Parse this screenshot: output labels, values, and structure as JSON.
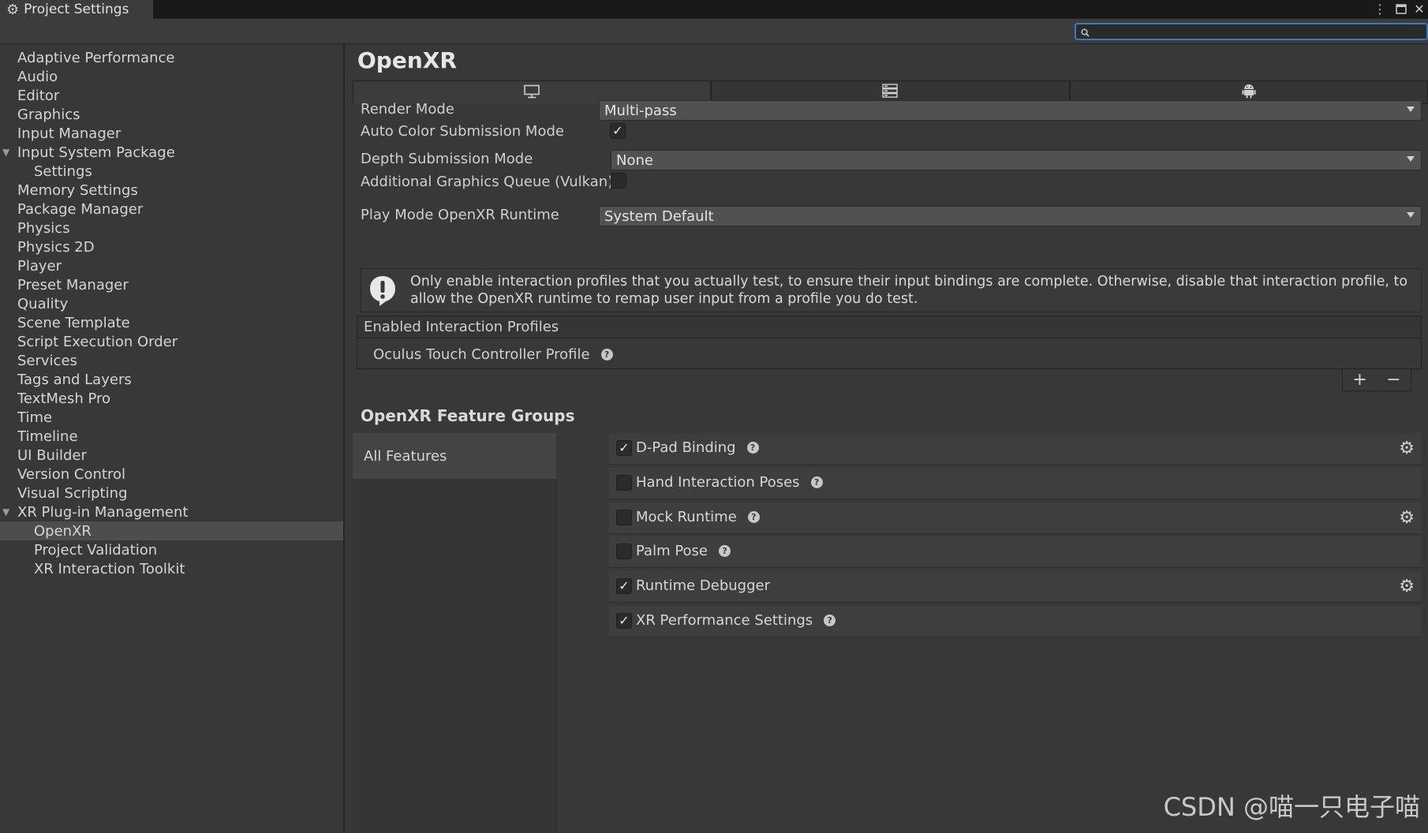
{
  "window": {
    "title": "Project Settings",
    "menu_icon": "kebab-menu-icon",
    "maximize_icon": "maximize-icon",
    "close_icon": "close-icon"
  },
  "search": {
    "value": "",
    "placeholder": ""
  },
  "sidebar": {
    "items": [
      {
        "label": "Adaptive Performance"
      },
      {
        "label": "Audio"
      },
      {
        "label": "Editor"
      },
      {
        "label": "Graphics"
      },
      {
        "label": "Input Manager"
      },
      {
        "label": "Input System Package"
      },
      {
        "label": "Settings"
      },
      {
        "label": "Memory Settings"
      },
      {
        "label": "Package Manager"
      },
      {
        "label": "Physics"
      },
      {
        "label": "Physics 2D"
      },
      {
        "label": "Player"
      },
      {
        "label": "Preset Manager"
      },
      {
        "label": "Quality"
      },
      {
        "label": "Scene Template"
      },
      {
        "label": "Script Execution Order"
      },
      {
        "label": "Services"
      },
      {
        "label": "Tags and Layers"
      },
      {
        "label": "TextMesh Pro"
      },
      {
        "label": "Time"
      },
      {
        "label": "Timeline"
      },
      {
        "label": "UI Builder"
      },
      {
        "label": "Version Control"
      },
      {
        "label": "Visual Scripting"
      },
      {
        "label": "XR Plug-in Management"
      },
      {
        "label": "OpenXR"
      },
      {
        "label": "Project Validation"
      },
      {
        "label": "XR Interaction Toolkit"
      }
    ],
    "selected": "OpenXR"
  },
  "main": {
    "title": "OpenXR",
    "platform_tabs": [
      {
        "icon": "desktop-monitor-icon",
        "active": true
      },
      {
        "icon": "server-stack-icon",
        "active": false
      },
      {
        "icon": "android-icon",
        "active": false
      }
    ],
    "render_mode": {
      "label": "Render Mode",
      "value": "Multi-pass"
    },
    "auto_color": {
      "label": "Auto Color Submission Mode",
      "checked": true
    },
    "depth_mode": {
      "label": "Depth Submission Mode",
      "value": "None"
    },
    "additional_queue": {
      "label": "Additional Graphics Queue (Vulkan)",
      "checked": false
    },
    "play_mode_runtime": {
      "label": "Play Mode OpenXR Runtime",
      "value": "System Default"
    },
    "warning": "Only enable interaction profiles that you actually test, to ensure their input bindings are complete. Otherwise, disable that interaction profile, to allow the OpenXR runtime to remap user input from a profile you do test.",
    "profiles": {
      "header": "Enabled Interaction Profiles",
      "items": [
        "Oculus Touch Controller Profile"
      ],
      "add_label": "+",
      "remove_label": "−"
    },
    "feature_groups": {
      "title": "OpenXR Feature Groups",
      "groups": [
        "All Features"
      ],
      "features": [
        {
          "name": "D-Pad Binding",
          "checked": true,
          "help": true,
          "gear": true
        },
        {
          "name": "Hand Interaction Poses",
          "checked": false,
          "help": true,
          "gear": false
        },
        {
          "name": "Mock Runtime",
          "checked": false,
          "help": true,
          "gear": true
        },
        {
          "name": "Palm Pose",
          "checked": false,
          "help": true,
          "gear": false
        },
        {
          "name": "Runtime Debugger",
          "checked": true,
          "help": false,
          "gear": true
        },
        {
          "name": "XR Performance Settings",
          "checked": true,
          "help": true,
          "gear": false
        }
      ]
    }
  },
  "watermark": "CSDN @喵一只电子喵",
  "colors": {
    "background": "#383838",
    "titlebar": "#191919",
    "search_focus": "#3a79bb",
    "selected_row": "#4d4d4d"
  }
}
